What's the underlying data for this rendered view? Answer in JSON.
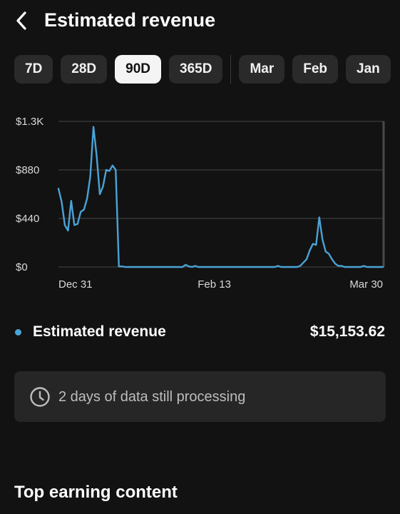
{
  "header": {
    "back_icon": "chevron-left-icon",
    "title": "Estimated revenue"
  },
  "range_chips": [
    {
      "label": "7D",
      "selected": false
    },
    {
      "label": "28D",
      "selected": false
    },
    {
      "label": "90D",
      "selected": true
    },
    {
      "label": "365D",
      "selected": false
    }
  ],
  "month_chips": [
    {
      "label": "Mar",
      "selected": false
    },
    {
      "label": "Feb",
      "selected": false
    },
    {
      "label": "Jan",
      "selected": false
    }
  ],
  "chart_data": {
    "type": "line",
    "series": [
      {
        "color": "#4aa3d6",
        "values": [
          710,
          590,
          380,
          330,
          600,
          380,
          390,
          500,
          520,
          620,
          820,
          1270,
          1010,
          660,
          730,
          880,
          870,
          920,
          880,
          5,
          5,
          0,
          0,
          0,
          0,
          0,
          0,
          0,
          0,
          0,
          0,
          0,
          0,
          0,
          0,
          0,
          0,
          0,
          0,
          0,
          20,
          5,
          0,
          10,
          0,
          0,
          0,
          0,
          0,
          0,
          0,
          0,
          0,
          0,
          0,
          0,
          0,
          0,
          0,
          0,
          0,
          0,
          0,
          0,
          0,
          0,
          0,
          0,
          0,
          10,
          0,
          0,
          0,
          0,
          0,
          0,
          10,
          40,
          70,
          150,
          210,
          200,
          450,
          250,
          140,
          120,
          70,
          30,
          10,
          10,
          0,
          0,
          0,
          0,
          0,
          0,
          10,
          0,
          0,
          0,
          0,
          0,
          0
        ]
      }
    ],
    "x_ticks": [
      {
        "label": "Dec 31",
        "index": 6
      },
      {
        "label": "Feb 13",
        "index": 49
      },
      {
        "label": "Mar 30",
        "index": 97
      }
    ],
    "y_ticks": [
      {
        "label": "$0",
        "value": 0
      },
      {
        "label": "$440",
        "value": 440
      },
      {
        "label": "$880",
        "value": 880
      },
      {
        "label": "$1.3K",
        "value": 1320
      }
    ],
    "ylim": [
      0,
      1320
    ],
    "grid": true
  },
  "summary": {
    "dot_color": "#4aa3d6",
    "label": "Estimated revenue",
    "value": "$15,153.62"
  },
  "notice": {
    "icon": "clock-icon",
    "text": "2 days of data still processing"
  },
  "section": {
    "title": "Top earning content"
  }
}
